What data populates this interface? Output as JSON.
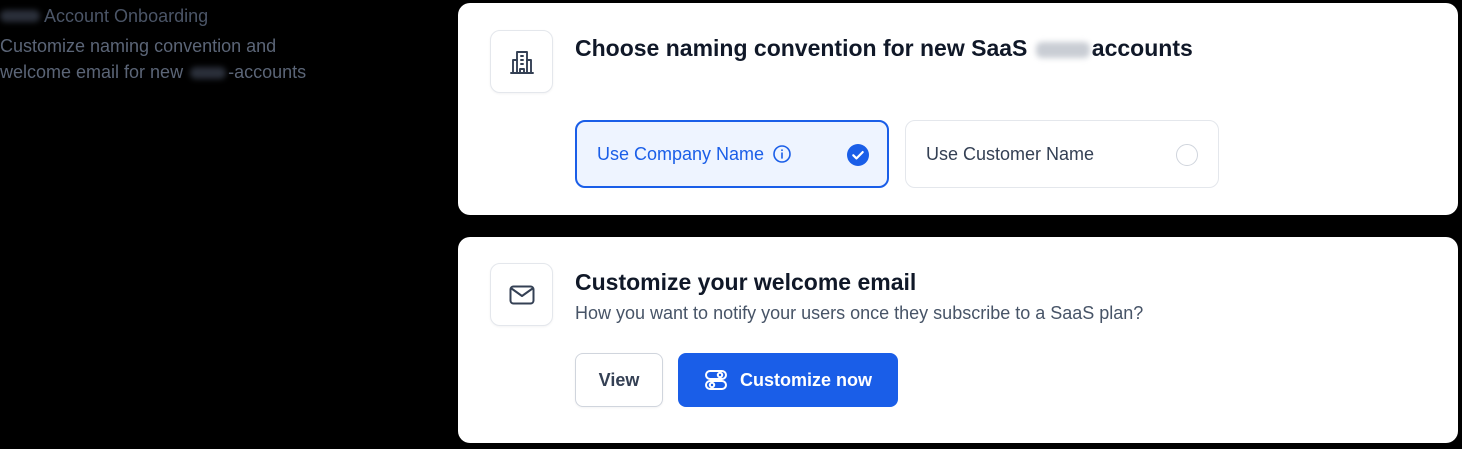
{
  "sidebar": {
    "title": "Account Onboarding",
    "description_line1": "Customize naming convention and",
    "description_line2_prefix": "welcome email for new",
    "description_line2_suffix": "-accounts"
  },
  "naming_card": {
    "icon": "building-icon",
    "title_prefix": "Choose naming convention for new SaaS",
    "title_suffix": "accounts",
    "options": [
      {
        "label": "Use Company Name",
        "selected": true,
        "icon": "info-icon"
      },
      {
        "label": "Use Customer Name",
        "selected": false
      }
    ]
  },
  "email_card": {
    "icon": "mail-icon",
    "title": "Customize your welcome email",
    "subtitle": "How you want to notify your users once they subscribe to a SaaS plan?",
    "view_label": "View",
    "customize_label": "Customize now",
    "customize_icon": "toggles-icon"
  },
  "colors": {
    "accent": "#1a5ee8",
    "selected_bg": "#eef4ff",
    "page_bg": "#000000",
    "card_bg": "#ffffff"
  }
}
